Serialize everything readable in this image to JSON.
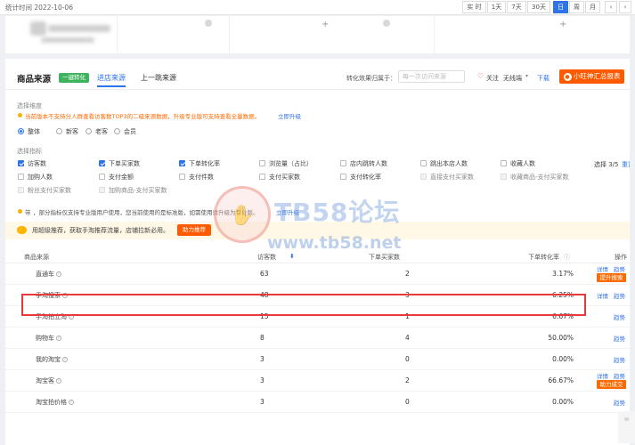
{
  "topbar": {
    "date_label": "统计时间 2022-10-06",
    "range_buttons": [
      "实 时",
      "1天",
      "7天",
      "30天",
      "日",
      "周",
      "月"
    ],
    "nav_prev": "‹",
    "nav_next": "›"
  },
  "section": {
    "title": "商品来源",
    "badge": "一键转化",
    "tabs": [
      "进店来源",
      "上一跳来源"
    ],
    "effect_label": "转化效果归属于：",
    "effect_placeholder": "每一次访问来源",
    "follow": "关注",
    "subscribe": "无线端",
    "download": "下载",
    "cta": "小旺神汇总报表"
  },
  "dimension": {
    "label": "选择维度",
    "tip": "当前版本不支持分人群查看访客数TOP3的二级来源数据，升级专业版可支持查看全量数据。",
    "tip_link": "立即升级",
    "options": [
      "整体",
      "新客",
      "老客",
      "会员"
    ],
    "selected": "整体"
  },
  "metrics": {
    "label": "选择指标",
    "items": [
      {
        "label": "访客数",
        "checked": true,
        "disabled": false
      },
      {
        "label": "下单买家数",
        "checked": true,
        "disabled": false
      },
      {
        "label": "下单转化率",
        "checked": true,
        "disabled": false
      },
      {
        "label": "浏览量（占比）",
        "checked": false,
        "disabled": false
      },
      {
        "label": "店内跳转人数",
        "checked": false,
        "disabled": false
      },
      {
        "label": "跳出本店人数",
        "checked": false,
        "disabled": false
      },
      {
        "label": "收藏人数",
        "checked": false,
        "disabled": false
      },
      {
        "label": "加购人数",
        "checked": false,
        "disabled": false
      },
      {
        "label": "支付金额",
        "checked": false,
        "disabled": false
      },
      {
        "label": "支付件数",
        "checked": false,
        "disabled": false
      },
      {
        "label": "支付买家数",
        "checked": false,
        "disabled": false
      },
      {
        "label": "支付转化率",
        "checked": false,
        "disabled": false
      },
      {
        "label": "直接支付买家数",
        "checked": false,
        "disabled": true
      },
      {
        "label": "收藏商品-支付买家数",
        "checked": false,
        "disabled": true
      },
      {
        "label": "粉丝支付买家数",
        "checked": false,
        "disabled": true
      },
      {
        "label": "加购商品-支付买家数",
        "checked": false,
        "disabled": true
      }
    ],
    "count": "选择 3/5",
    "reset": "重置",
    "note": "带",
    "note_rest": "，部分指标仅支持专业版用户使用，您当前使用的是标准版，如需使用请升级为专业版。",
    "note_link": "立即升级"
  },
  "banner": {
    "text": "用超级推荐，获取手淘推荐流量，店铺拉新必用。",
    "button": "助力推荐"
  },
  "table": {
    "headers": [
      "商品来源",
      "访客数",
      "下单买家数",
      "下单转化率",
      "操作"
    ],
    "rows": [
      {
        "source": "直通车",
        "visitors": "63",
        "buyers": "2",
        "rate": "3.17%",
        "ops": [
          "详情",
          "趋势"
        ],
        "tag": "提升搜索"
      },
      {
        "source": "手淘搜索",
        "visitors": "48",
        "buyers": "3",
        "rate": "6.25%",
        "ops": [
          "详情",
          "趋势"
        ],
        "tag": ""
      },
      {
        "source": "手淘拍立淘",
        "visitors": "15",
        "buyers": "1",
        "rate": "6.67%",
        "ops": [
          "趋势"
        ],
        "tag": ""
      },
      {
        "source": "购物车",
        "visitors": "8",
        "buyers": "4",
        "rate": "50.00%",
        "ops": [
          "趋势"
        ],
        "tag": ""
      },
      {
        "source": "我的淘宝",
        "visitors": "3",
        "buyers": "0",
        "rate": "0.00%",
        "ops": [
          "趋势"
        ],
        "tag": ""
      },
      {
        "source": "淘宝客",
        "visitors": "3",
        "buyers": "2",
        "rate": "66.67%",
        "ops": [
          "详情",
          "趋势"
        ],
        "tag": "助力成交"
      },
      {
        "source": "淘宝拍价格",
        "visitors": "3",
        "buyers": "0",
        "rate": "0.00%",
        "ops": [
          "趋势"
        ],
        "tag": ""
      }
    ]
  },
  "watermark": {
    "logo": "✋",
    "title": "TB58论坛",
    "url": "www.tb58.net"
  },
  "colors": {
    "accent": "#2f73e8",
    "cta": "#ff5a00",
    "highlight": "#e83a3a",
    "green": "#3cb35c"
  }
}
